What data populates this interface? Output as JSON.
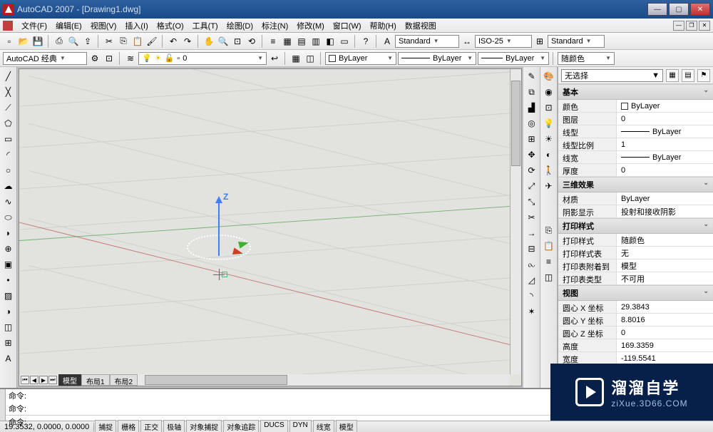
{
  "title": "AutoCAD 2007 - [Drawing1.dwg]",
  "menu": [
    "文件(F)",
    "编辑(E)",
    "视图(V)",
    "插入(I)",
    "格式(O)",
    "工具(T)",
    "绘图(D)",
    "标注(N)",
    "修改(M)",
    "窗口(W)",
    "帮助(H)",
    "数据视图"
  ],
  "workspace": "AutoCAD 经典",
  "layer_current": "0",
  "style_standard": "Standard",
  "style_iso": "ISO-25",
  "style_table": "Standard",
  "bylayer": "ByLayer",
  "bycolor": "随颜色",
  "tabs": {
    "model": "模型",
    "layout1": "布局1",
    "layout2": "布局2"
  },
  "props": {
    "selector": "无选择",
    "groups": {
      "basic": {
        "title": "基本",
        "rows": [
          {
            "k": "颜色",
            "v": "ByLayer",
            "swatch": true
          },
          {
            "k": "图层",
            "v": "0"
          },
          {
            "k": "线型",
            "v": "ByLayer",
            "line": true
          },
          {
            "k": "线型比例",
            "v": "1"
          },
          {
            "k": "线宽",
            "v": "ByLayer",
            "line": true
          },
          {
            "k": "厚度",
            "v": "0"
          }
        ]
      },
      "threeD": {
        "title": "三维效果",
        "rows": [
          {
            "k": "材质",
            "v": "ByLayer"
          },
          {
            "k": "阴影显示",
            "v": "投射和接收阴影"
          }
        ]
      },
      "print": {
        "title": "打印样式",
        "rows": [
          {
            "k": "打印样式",
            "v": "随颜色"
          },
          {
            "k": "打印样式表",
            "v": "无"
          },
          {
            "k": "打印表附着到",
            "v": "模型"
          },
          {
            "k": "打印表类型",
            "v": "不可用"
          }
        ]
      },
      "view": {
        "title": "视图",
        "rows": [
          {
            "k": "圆心 X 坐标",
            "v": "29.3843"
          },
          {
            "k": "圆心 Y 坐标",
            "v": "8.8016"
          },
          {
            "k": "圆心 Z 坐标",
            "v": "0"
          },
          {
            "k": "高度",
            "v": "169.3359"
          },
          {
            "k": "宽度",
            "v": "-119.5541"
          }
        ]
      }
    }
  },
  "cmd": {
    "prompt": "命令:",
    "input_prompt": "命令:"
  },
  "status": {
    "coords": "19.3532, 0.0000, 0.0000",
    "buttons": [
      "捕捉",
      "栅格",
      "正交",
      "极轴",
      "对象捕捉",
      "对象追踪",
      "DUCS",
      "DYN",
      "线宽",
      "模型"
    ]
  },
  "watermark": {
    "big": "溜溜自学",
    "url": "ziXue.3D66.COM"
  },
  "ucs_z": "Z"
}
